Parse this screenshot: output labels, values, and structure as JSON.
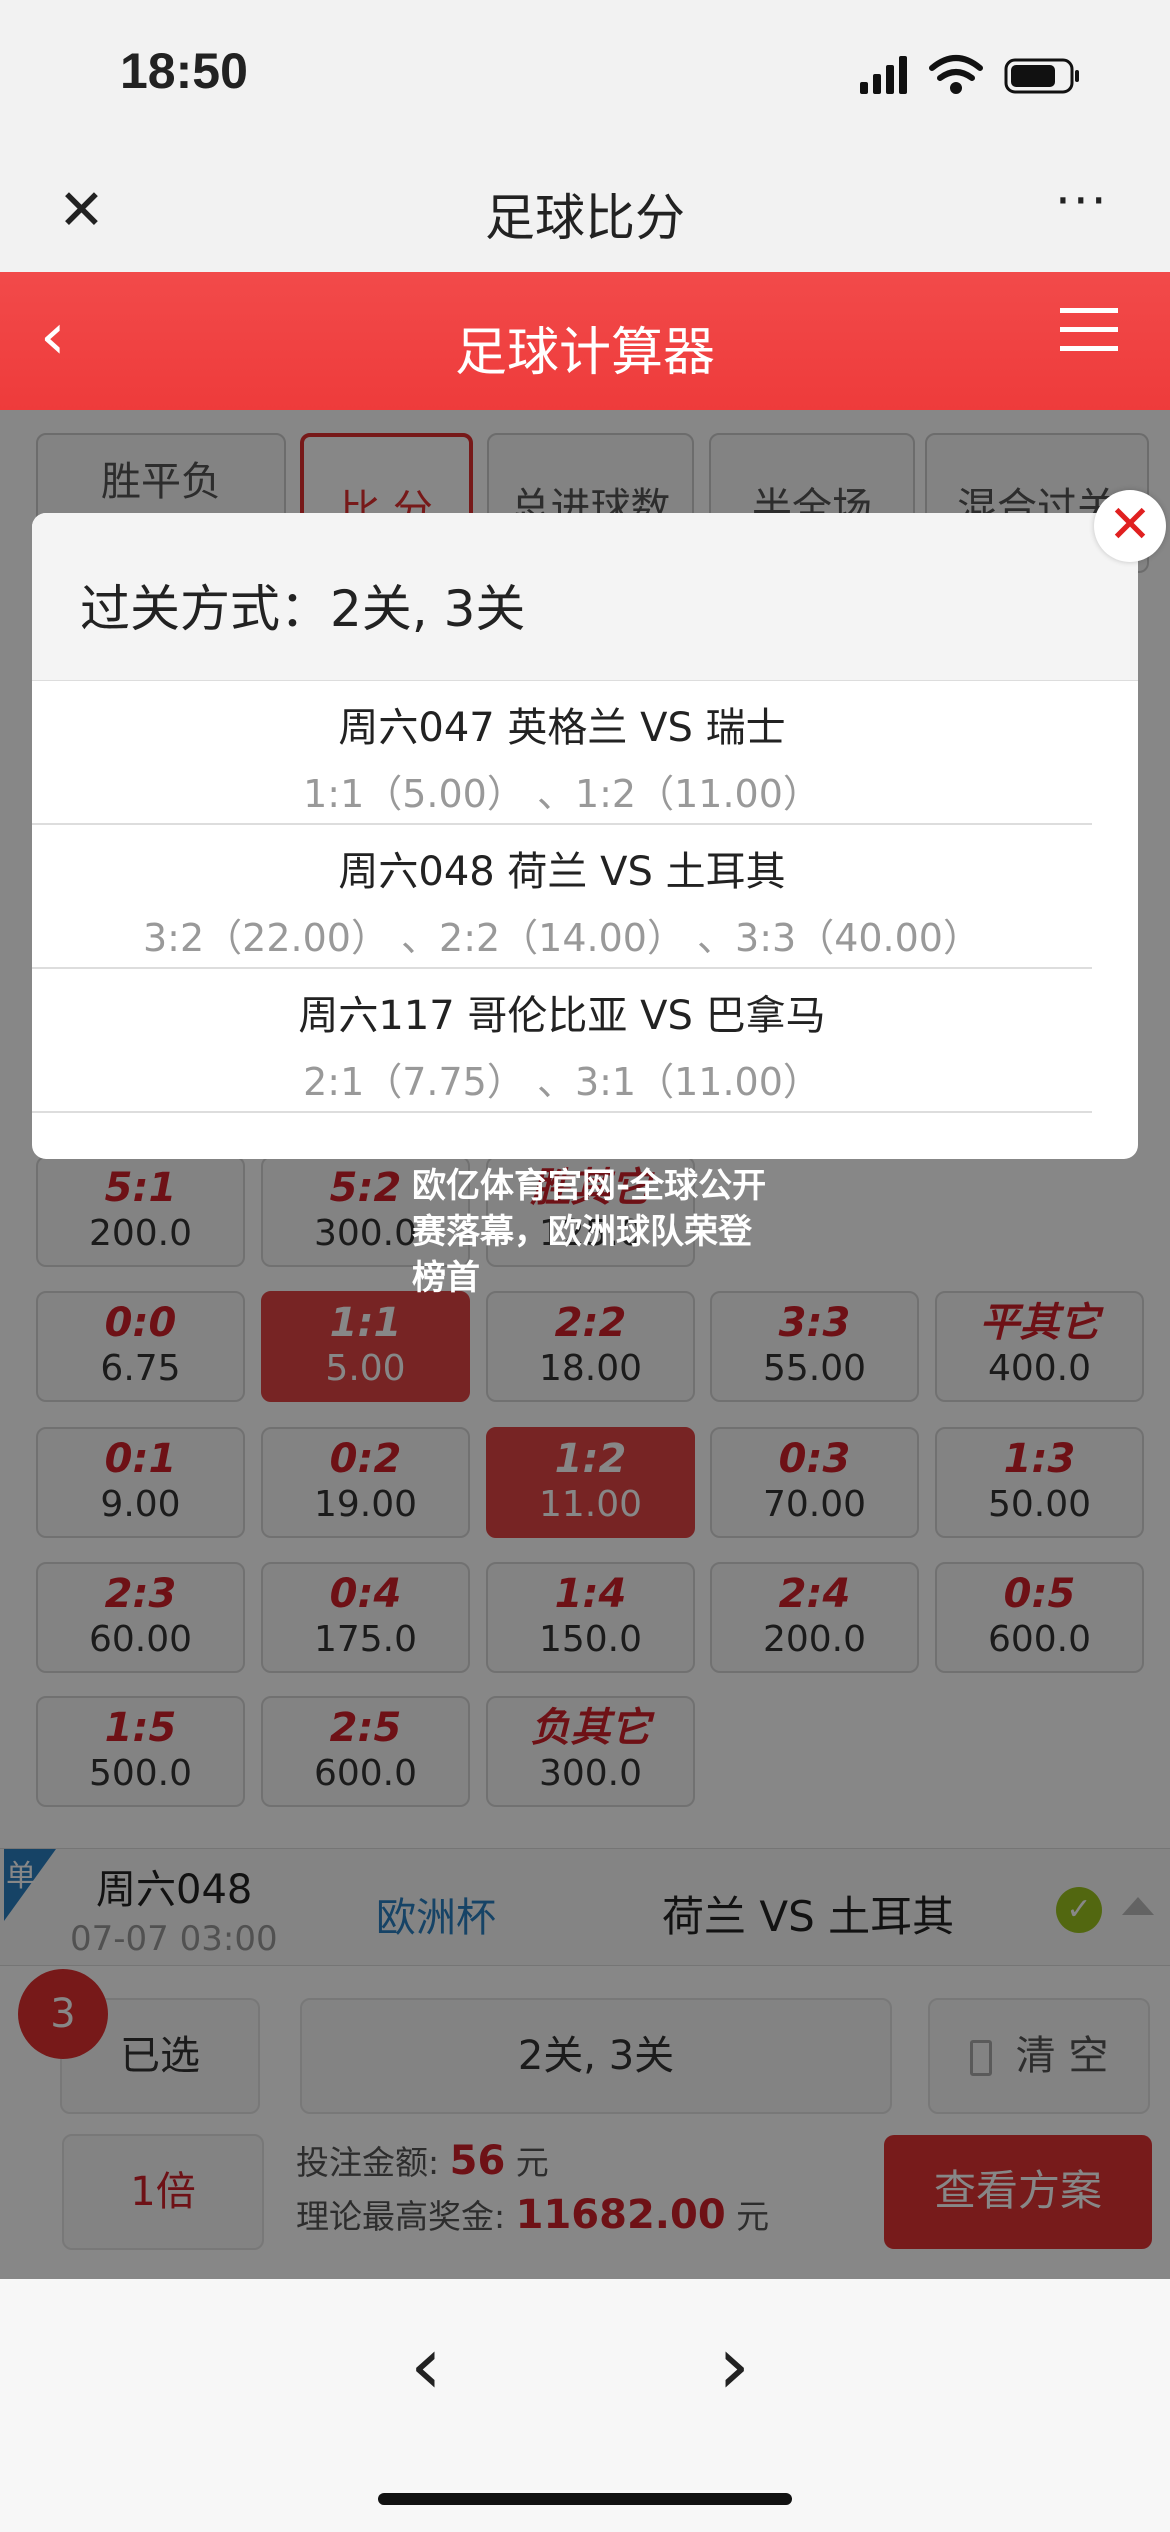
{
  "status": {
    "time": "18:50"
  },
  "nav": {
    "title": "足球比分"
  },
  "header": {
    "title": "足球计算器"
  },
  "tabs": [
    "胜平负",
    "比 分",
    "总进球数",
    "半全场",
    "混合过关"
  ],
  "modal": {
    "title": "过关方式：2关, 3关",
    "rows": [
      {
        "match": "周六047 英格兰 VS 瑞士",
        "picks": "1:1（5.00） 、1:2（11.00）"
      },
      {
        "match": "周六048 荷兰 VS 土耳其",
        "picks": "3:2（22.00） 、2:2（14.00） 、3:3（40.00）"
      },
      {
        "match": "周六117 哥伦比亚 VS 巴拿马",
        "picks": "2:1（7.75） 、3:1（11.00）"
      }
    ]
  },
  "grid": [
    [
      {
        "s": "5:1",
        "o": "200.0"
      },
      {
        "s": "5:2",
        "o": "300.0"
      },
      {
        "s": "胜其它",
        "o": "125.0"
      }
    ],
    [
      {
        "s": "0:0",
        "o": "6.75"
      },
      {
        "s": "1:1",
        "o": "5.00",
        "sel": true
      },
      {
        "s": "2:2",
        "o": "18.00"
      },
      {
        "s": "3:3",
        "o": "55.00"
      },
      {
        "s": "平其它",
        "o": "400.0"
      }
    ],
    [
      {
        "s": "0:1",
        "o": "9.00"
      },
      {
        "s": "0:2",
        "o": "19.00"
      },
      {
        "s": "1:2",
        "o": "11.00",
        "sel": true
      },
      {
        "s": "0:3",
        "o": "70.00"
      },
      {
        "s": "1:3",
        "o": "50.00"
      }
    ],
    [
      {
        "s": "2:3",
        "o": "60.00"
      },
      {
        "s": "0:4",
        "o": "175.0"
      },
      {
        "s": "1:4",
        "o": "150.0"
      },
      {
        "s": "2:4",
        "o": "200.0"
      },
      {
        "s": "0:5",
        "o": "600.0"
      }
    ],
    [
      {
        "s": "1:5",
        "o": "500.0"
      },
      {
        "s": "2:5",
        "o": "600.0"
      },
      {
        "s": "负其它",
        "o": "300.0"
      }
    ]
  ],
  "match": {
    "tag": "单",
    "id": "周六048",
    "time": "07-07 03:00",
    "league": "欧洲杯",
    "teams": "荷兰 VS 土耳其"
  },
  "footer": {
    "count": "3",
    "selected": "已选",
    "pass": "2关, 3关",
    "clear": "清 空",
    "multiple": "1倍",
    "bet_label": "投注金额:",
    "bet": "56",
    "unit": "元",
    "max_label": "理论最高奖金:",
    "max": "11682.00",
    "view": "查看方案"
  },
  "watermark": "欧亿体育官网-全球公开赛落幕，欧洲球队荣登榜首",
  "colors": {
    "accent": "#ee3b3b",
    "selected": "#e04444",
    "league": "#2a7fc0",
    "check": "#9bc31f"
  }
}
